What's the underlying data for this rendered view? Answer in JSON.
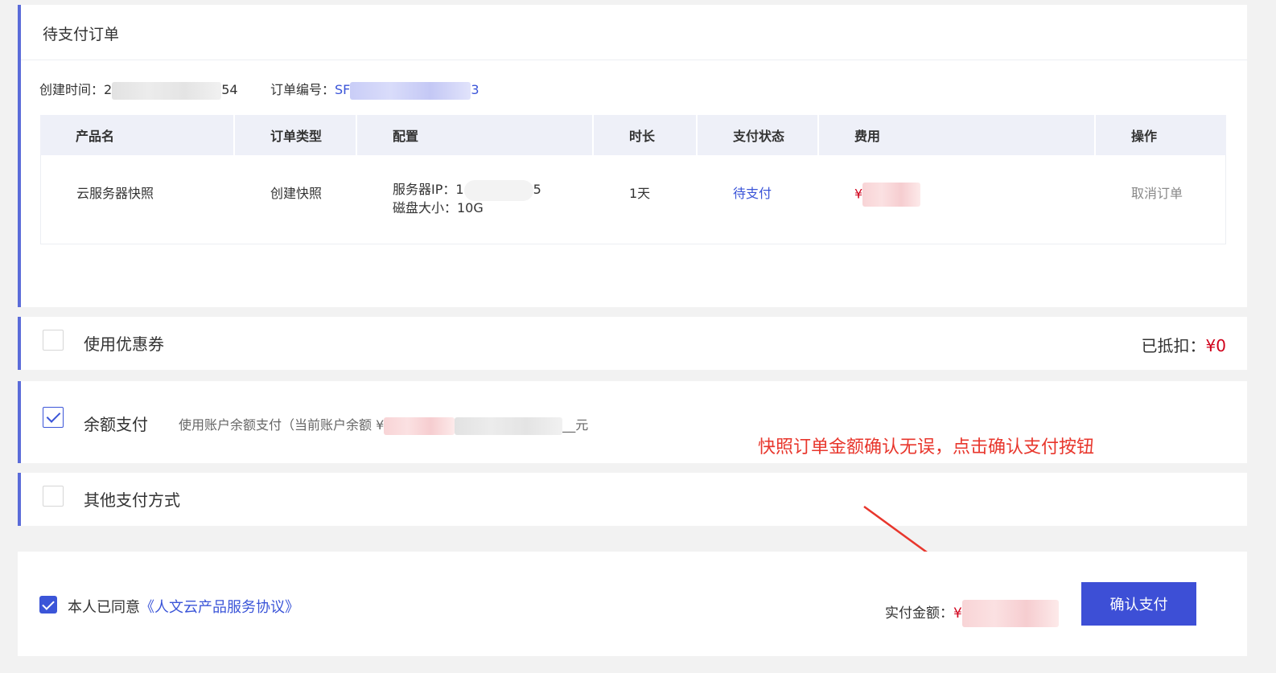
{
  "order": {
    "title": "待支付订单",
    "created_label": "创建时间：",
    "created_visible_start": "2",
    "created_visible_end": "54",
    "order_no_label": "订单编号：",
    "order_no_visible_start": "SF",
    "order_no_visible_end": "3"
  },
  "table": {
    "headers": [
      "产品名",
      "订单类型",
      "配置",
      "时长",
      "支付状态",
      "费用",
      "操作"
    ],
    "row": {
      "product": "云服务器快照",
      "order_type": "创建快照",
      "config_ip_label": "服务器IP：",
      "config_ip_visible_start": "1",
      "config_ip_visible_end": "5",
      "config_disk": "磁盘大小：10G",
      "duration": "1天",
      "status": "待支付",
      "fee_symbol": "¥",
      "action": "取消订单"
    }
  },
  "coupon": {
    "label": "使用优惠券",
    "deduct_label": "已抵扣：",
    "deduct_amount": "¥0"
  },
  "balance": {
    "label": "余额支付",
    "hint_prefix": "使用账户余额支付（当前账户余额 ¥",
    "hint_suffix": "__元"
  },
  "other": {
    "label": "其他支付方式"
  },
  "annotation": {
    "text": "快照订单金额确认无误，点击确认支付按钮"
  },
  "footer": {
    "agree_prefix": "本人已同意",
    "agree_link": "《人文云产品服务协议》",
    "pay_label": "实付金额：",
    "pay_symbol": "¥",
    "confirm_button": "确认支付"
  },
  "colors": {
    "accent": "#5b6cd9",
    "link": "#3b55d8",
    "price": "#d0021b",
    "annotation": "#e8362c",
    "button": "#3d4fd6"
  }
}
